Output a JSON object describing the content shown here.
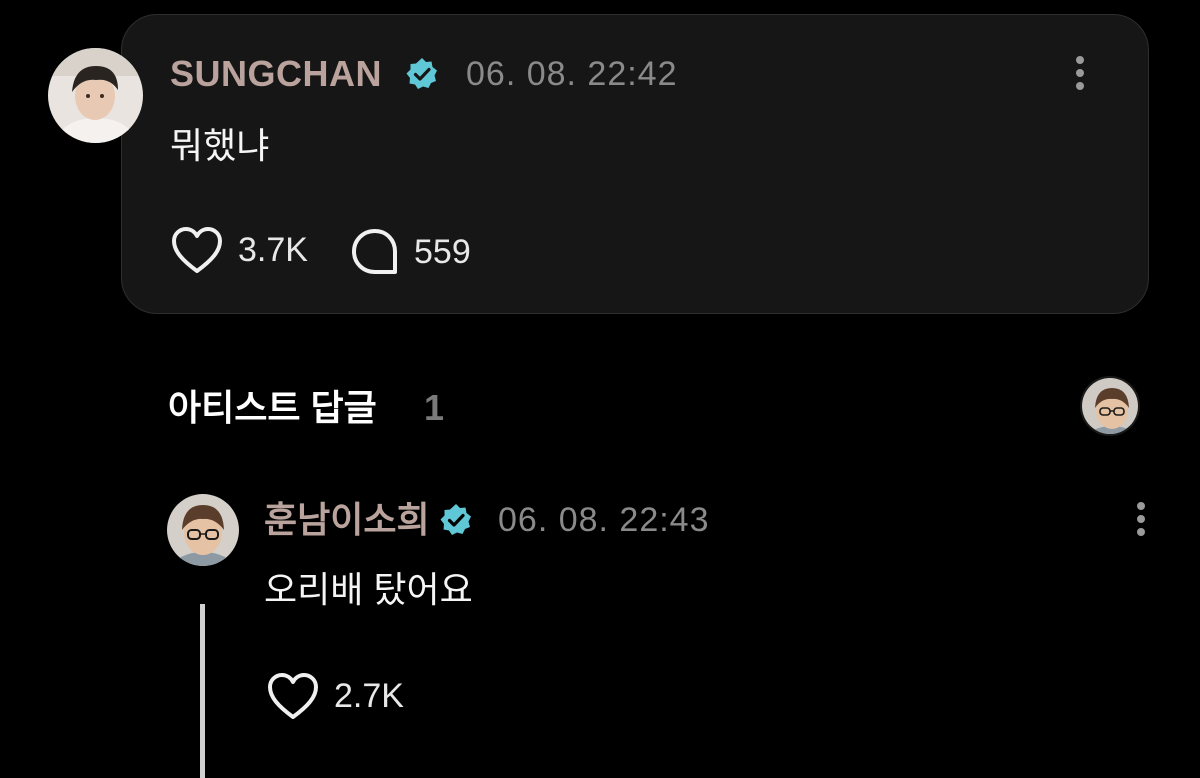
{
  "post": {
    "author": "SUNGCHAN",
    "timestamp": "06. 08. 22:42",
    "text": "뭐했냐",
    "likes": "3.7K",
    "comments": "559",
    "verified_icon": "verified-badge-icon",
    "more_icon": "more-vertical-icon"
  },
  "artist_replies": {
    "label": "아티스트 답글",
    "count": "1"
  },
  "reply": {
    "author": "훈남이소희",
    "timestamp": "06. 08. 22:43",
    "text": "오리배 탔어요",
    "likes": "2.7K"
  },
  "colors": {
    "background": "#000000",
    "card": "#161616",
    "author_name": "#b9a39c",
    "verified_badge": "#5fc7d6",
    "timestamp": "#8a8a8a"
  }
}
